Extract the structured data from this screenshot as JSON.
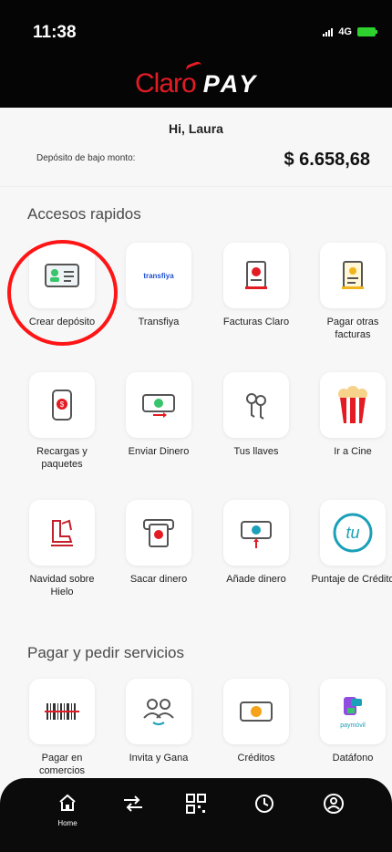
{
  "status": {
    "time": "11:38",
    "network": "4G"
  },
  "brand": {
    "claro": "Claro",
    "pay": "PAY"
  },
  "greeting": "Hi, Laura",
  "balance": {
    "label": "Depósito de bajo monto:",
    "value": "$ 6.658,68"
  },
  "sections": {
    "quick_access": "Accesos rapidos",
    "services": "Pagar y pedir servicios"
  },
  "tiles": [
    {
      "label": "Crear depósito",
      "icon": "id-card-icon"
    },
    {
      "label": "Transfiya",
      "icon": "transfiya-icon",
      "logo_text": "transfiya"
    },
    {
      "label": "Facturas Claro",
      "icon": "bill-icon"
    },
    {
      "label": "Pagar otras facturas",
      "icon": "receipt-icon"
    },
    {
      "label": "Recargas y paquetes",
      "icon": "phone-recharge-icon"
    },
    {
      "label": "Enviar Dinero",
      "icon": "send-money-icon"
    },
    {
      "label": "Tus llaves",
      "icon": "keys-icon"
    },
    {
      "label": "Ir a Cine",
      "icon": "popcorn-icon"
    },
    {
      "label": "Navidad sobre Hielo",
      "icon": "ice-skate-icon"
    },
    {
      "label": "Sacar dinero",
      "icon": "withdraw-icon"
    },
    {
      "label": "Añade dinero",
      "icon": "add-money-icon"
    },
    {
      "label": "Puntaje de Crédito",
      "icon": "tu-credit-icon",
      "logo_text": "tu"
    },
    {
      "label": "Pagar en comercios",
      "icon": "barcode-icon"
    },
    {
      "label": "Invita y Gana",
      "icon": "invite-icon"
    },
    {
      "label": "Créditos",
      "icon": "credit-icon"
    },
    {
      "label": "Datáfono",
      "icon": "paymovil-icon",
      "logo_text": "paymóvil"
    }
  ],
  "nav": {
    "home": "Home"
  },
  "colors": {
    "brand_red": "#e31b23",
    "accent_blue": "#1aa0b8",
    "accent_green": "#37c46a"
  }
}
